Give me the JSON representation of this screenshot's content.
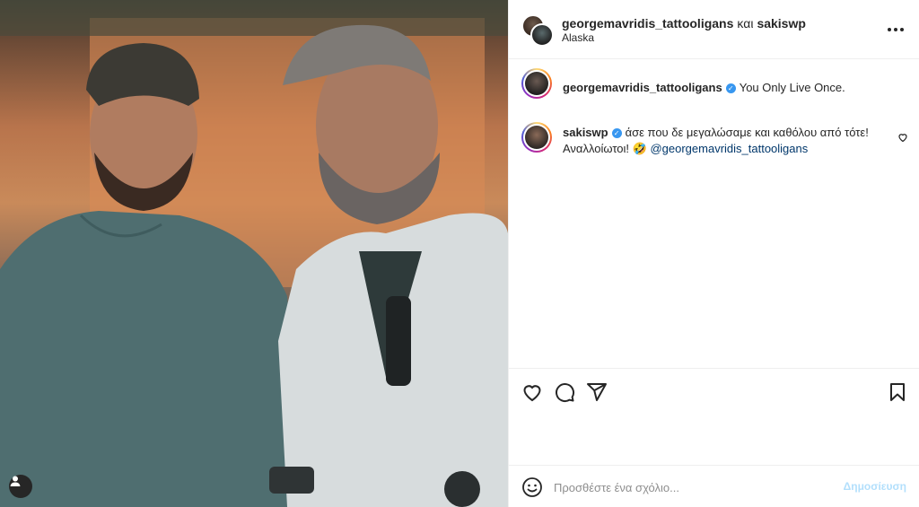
{
  "header": {
    "user1": "georgemavridis_tattooligans",
    "and_word": "και",
    "user2": "sakiswp",
    "location": "Alaska"
  },
  "comments": [
    {
      "username": "georgemavridis_tattooligans",
      "verified": true,
      "text": "You Only Live Once."
    },
    {
      "username": "sakiswp",
      "verified": true,
      "text_line1": "άσε που δε μεγαλώσαμε και καθόλου από τότε!",
      "text_line2_prefix": "Αναλλοίωτοι! 🤣",
      "mention": "@georgemavridis_tattooligans"
    }
  ],
  "add_comment": {
    "placeholder": "Προσθέστε ένα σχόλιο...",
    "post_label": "Δημοσίευση"
  },
  "icons": {
    "like": "heart-icon",
    "comment": "comment-icon",
    "share": "share-icon",
    "save": "bookmark-icon",
    "emoji": "smiley-icon",
    "tagged_users": "user-icon",
    "options": "more-icon"
  },
  "colors": {
    "verified": "#3897f0",
    "mention": "#00376b",
    "post_button": "#b2dffc"
  }
}
